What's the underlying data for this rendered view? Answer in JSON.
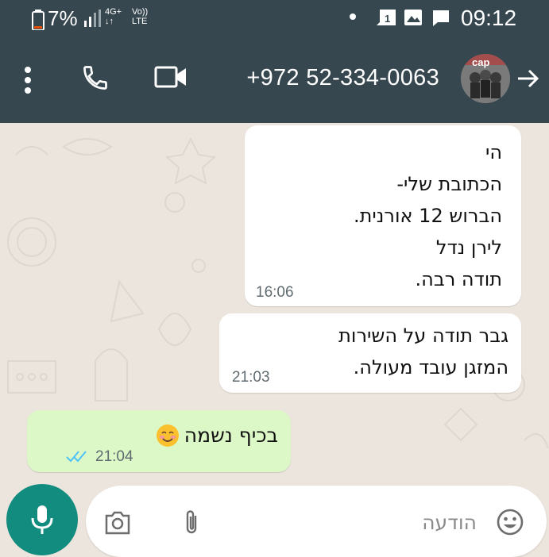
{
  "status_bar": {
    "battery": "7%",
    "network_type": "4G+",
    "volte_top": "Vo))",
    "volte_bottom": "LTE",
    "time": "09:12"
  },
  "header": {
    "contact": "+972 52-334-0063",
    "avatar_text": "cap",
    "icons": [
      "more-vert-icon",
      "call-icon",
      "video-call-icon",
      "back-arrow-icon"
    ]
  },
  "messages": [
    {
      "direction": "incoming",
      "lines": [
        "הי",
        "הכתובת שלי-",
        "הברוש 12 אורנית.",
        "לירן נדל",
        "תודה רבה."
      ],
      "time": "16:06"
    },
    {
      "direction": "incoming",
      "lines": [
        "גבר תודה על השירות",
        "המזגן עובד מעולה."
      ],
      "time": "21:03"
    },
    {
      "direction": "outgoing",
      "text": "בכיף נשמה",
      "emoji": "smiling-face-icon",
      "time": "21:04",
      "status": "read"
    }
  ],
  "composer": {
    "placeholder": "הודעה"
  },
  "colors": {
    "header_bg": "#37474f",
    "chat_bg": "#ece5dd",
    "outgoing_bubble": "#dcf8c6",
    "mic_button": "#128c7e",
    "read_ticks": "#4fc3f7"
  }
}
